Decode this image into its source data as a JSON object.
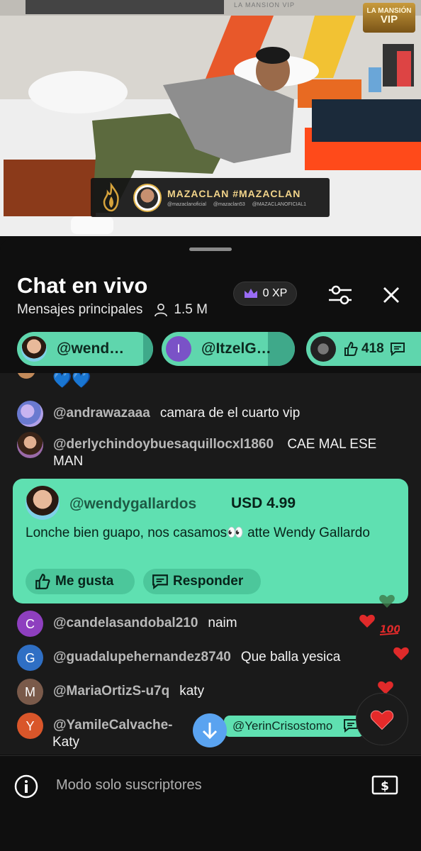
{
  "video": {
    "channel_logo_top": "LA MANSIÓN",
    "channel_logo_bottom": "VIP",
    "wall_text": "LA MANSION VIP",
    "lower_third": {
      "title": "MAZACLAN #MAZACLAN",
      "socials": [
        "@mazaclanoficial",
        "@mazaclan53",
        "@MAZACLANOFICIAL1"
      ]
    }
  },
  "header": {
    "title": "Chat en vivo",
    "subtitle": "Mensajes principales",
    "viewers": "1.5 M",
    "xp_label": "0 XP",
    "icons": [
      "crown-icon",
      "sliders-icon",
      "close-icon",
      "person-icon"
    ]
  },
  "pinned_chips": [
    {
      "name": "@wend…",
      "avatar": "photo"
    },
    {
      "name": "@ItzelG…",
      "avatar_initial": "I",
      "avatar_color": "#7a52c7"
    },
    {
      "likes": "418",
      "avatar": "photo"
    }
  ],
  "messages_top": [
    {
      "author": "",
      "text": "💙💙"
    },
    {
      "author": "@andrawazaaa",
      "text": "camara de el cuarto vip"
    },
    {
      "author": "@derlychindoybuesaquillocxl1860",
      "text": "CAE MAL ESE MAN"
    }
  ],
  "superchat": {
    "author": "@wendygallardos",
    "amount": "USD 4.99",
    "message": "Lonche bien guapo, nos casamos👀 atte Wendy Gallardo",
    "like_label": "Me gusta",
    "reply_label": "Responder"
  },
  "messages_bottom": [
    {
      "initial": "C",
      "color": "#8e3fbf",
      "author": "@candelasandobal210",
      "text": "naim"
    },
    {
      "initial": "G",
      "color": "#2f6fc4",
      "author": "@guadalupehernandez8740",
      "text": "Que balla yesica"
    },
    {
      "initial": "M",
      "color": "#7a5a4a",
      "author": "@MariaOrtizS-u7q",
      "text": "katy"
    },
    {
      "initial": "Y",
      "color": "#d9562a",
      "author": "@YamileCalvache-",
      "text": "Katy",
      "trail": "s"
    }
  ],
  "mention_pill": "@YerinCrisostomo",
  "input": {
    "placeholder": "Modo solo suscriptores"
  },
  "colors": {
    "accent_green": "#5fe0b1",
    "jump_blue": "#5aa3f0",
    "background": "#0f0f0f"
  }
}
